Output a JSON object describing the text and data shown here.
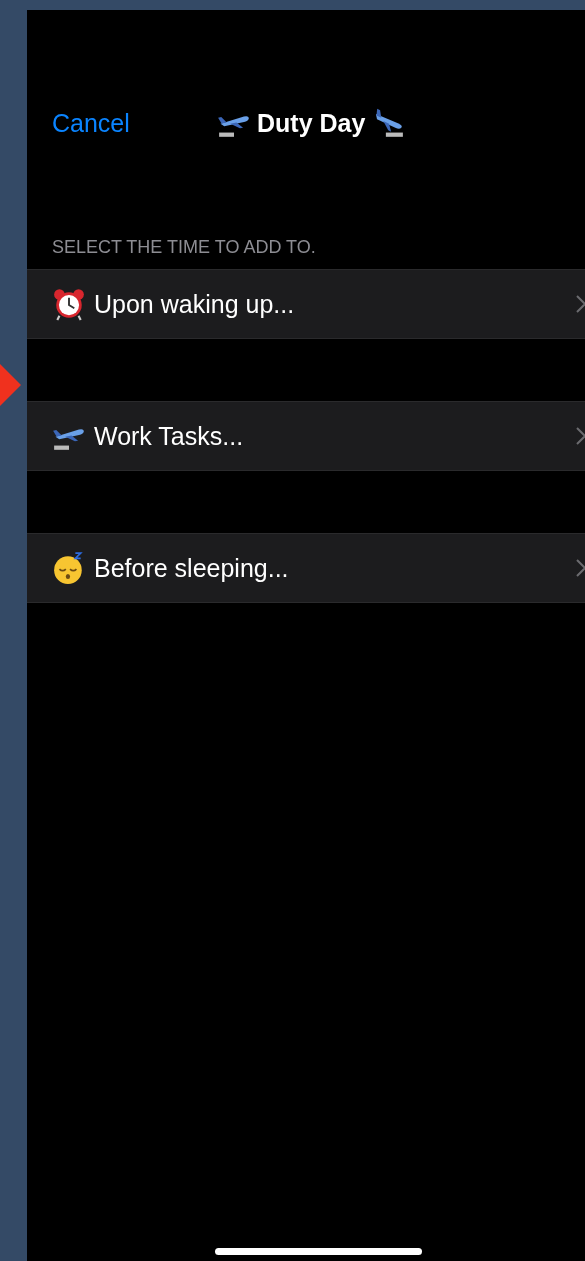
{
  "nav": {
    "cancel": "Cancel",
    "title": "Duty Day"
  },
  "section_header": "SELECT THE TIME TO ADD TO.",
  "rows": [
    {
      "kind": "alarm",
      "label": "Upon waking up..."
    },
    {
      "kind": "departure",
      "label": "Work Tasks..."
    },
    {
      "kind": "sleep",
      "label": "Before sleeping..."
    }
  ]
}
